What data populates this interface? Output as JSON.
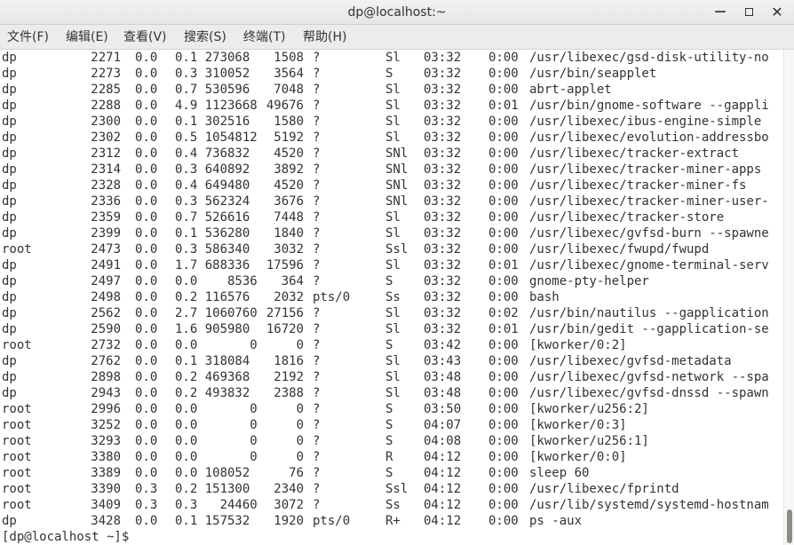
{
  "window": {
    "title": "dp@localhost:~",
    "minimize": "—",
    "close": "✕"
  },
  "menu": [
    "文件(F)",
    "编辑(E)",
    "查看(V)",
    "搜索(S)",
    "终端(T)",
    "帮助(H)"
  ],
  "rows": [
    [
      "dp",
      "2271",
      "0.0",
      "0.1 273068",
      "1508",
      "?",
      "Sl",
      "03:32",
      "0:00",
      "/usr/libexec/gsd-disk-utility-no"
    ],
    [
      "dp",
      "2273",
      "0.0",
      "0.3 310052",
      "3564",
      "?",
      "S",
      "03:32",
      "0:00",
      "/usr/bin/seapplet"
    ],
    [
      "dp",
      "2285",
      "0.0",
      "0.7 530596",
      "7048",
      "?",
      "Sl",
      "03:32",
      "0:00",
      "abrt-applet"
    ],
    [
      "dp",
      "2288",
      "0.0",
      "4.9 1123668",
      "49676",
      "?",
      "Sl",
      "03:32",
      "0:01",
      "/usr/bin/gnome-software --gappli"
    ],
    [
      "dp",
      "2300",
      "0.0",
      "0.1 302516",
      "1580",
      "?",
      "Sl",
      "03:32",
      "0:00",
      "/usr/libexec/ibus-engine-simple"
    ],
    [
      "dp",
      "2302",
      "0.0",
      "0.5 1054812",
      "5192",
      "?",
      "Sl",
      "03:32",
      "0:00",
      "/usr/libexec/evolution-addressbo"
    ],
    [
      "dp",
      "2312",
      "0.0",
      "0.4 736832",
      "4520",
      "?",
      "SNl",
      "03:32",
      "0:00",
      "/usr/libexec/tracker-extract"
    ],
    [
      "dp",
      "2314",
      "0.0",
      "0.3 640892",
      "3892",
      "?",
      "SNl",
      "03:32",
      "0:00",
      "/usr/libexec/tracker-miner-apps"
    ],
    [
      "dp",
      "2328",
      "0.0",
      "0.4 649480",
      "4520",
      "?",
      "SNl",
      "03:32",
      "0:00",
      "/usr/libexec/tracker-miner-fs"
    ],
    [
      "dp",
      "2336",
      "0.0",
      "0.3 562324",
      "3676",
      "?",
      "SNl",
      "03:32",
      "0:00",
      "/usr/libexec/tracker-miner-user-"
    ],
    [
      "dp",
      "2359",
      "0.0",
      "0.7 526616",
      "7448",
      "?",
      "Sl",
      "03:32",
      "0:00",
      "/usr/libexec/tracker-store"
    ],
    [
      "dp",
      "2399",
      "0.0",
      "0.1 536280",
      "1840",
      "?",
      "Sl",
      "03:32",
      "0:00",
      "/usr/libexec/gvfsd-burn --spawne"
    ],
    [
      "root",
      "2473",
      "0.0",
      "0.3 586340",
      "3032",
      "?",
      "Ssl",
      "03:32",
      "0:00",
      "/usr/libexec/fwupd/fwupd"
    ],
    [
      "dp",
      "2491",
      "0.0",
      "1.7 688336",
      "17596",
      "?",
      "Sl",
      "03:32",
      "0:01",
      "/usr/libexec/gnome-terminal-serv"
    ],
    [
      "dp",
      "2497",
      "0.0",
      "0.0    8536",
      "364",
      "?",
      "S",
      "03:32",
      "0:00",
      "gnome-pty-helper"
    ],
    [
      "dp",
      "2498",
      "0.0",
      "0.2 116576",
      "2032",
      "pts/0",
      "Ss",
      "03:32",
      "0:00",
      "bash"
    ],
    [
      "dp",
      "2562",
      "0.0",
      "2.7 1060760",
      "27156",
      "?",
      "Sl",
      "03:32",
      "0:02",
      "/usr/bin/nautilus --gapplication"
    ],
    [
      "dp",
      "2590",
      "0.0",
      "1.6 905980",
      "16720",
      "?",
      "Sl",
      "03:32",
      "0:01",
      "/usr/bin/gedit --gapplication-se"
    ],
    [
      "root",
      "2732",
      "0.0",
      "0.0       0",
      "0",
      "?",
      "S",
      "03:42",
      "0:00",
      "[kworker/0:2]"
    ],
    [
      "dp",
      "2762",
      "0.0",
      "0.1 318084",
      "1816",
      "?",
      "Sl",
      "03:43",
      "0:00",
      "/usr/libexec/gvfsd-metadata"
    ],
    [
      "dp",
      "2898",
      "0.0",
      "0.2 469368",
      "2192",
      "?",
      "Sl",
      "03:48",
      "0:00",
      "/usr/libexec/gvfsd-network --spa"
    ],
    [
      "dp",
      "2943",
      "0.0",
      "0.2 493832",
      "2388",
      "?",
      "Sl",
      "03:48",
      "0:00",
      "/usr/libexec/gvfsd-dnssd --spawn"
    ],
    [
      "root",
      "2996",
      "0.0",
      "0.0       0",
      "0",
      "?",
      "S",
      "03:50",
      "0:00",
      "[kworker/u256:2]"
    ],
    [
      "root",
      "3252",
      "0.0",
      "0.0       0",
      "0",
      "?",
      "S",
      "04:07",
      "0:00",
      "[kworker/0:3]"
    ],
    [
      "root",
      "3293",
      "0.0",
      "0.0       0",
      "0",
      "?",
      "S",
      "04:08",
      "0:00",
      "[kworker/u256:1]"
    ],
    [
      "root",
      "3380",
      "0.0",
      "0.0       0",
      "0",
      "?",
      "R",
      "04:12",
      "0:00",
      "[kworker/0:0]"
    ],
    [
      "root",
      "3389",
      "0.0",
      "0.0 108052",
      "76",
      "?",
      "S",
      "04:12",
      "0:00",
      "sleep 60"
    ],
    [
      "root",
      "3390",
      "0.3",
      "0.2 151300",
      "2340",
      "?",
      "Ssl",
      "04:12",
      "0:00",
      "/usr/libexec/fprintd"
    ],
    [
      "root",
      "3409",
      "0.3",
      "0.3   24460",
      "3072",
      "?",
      "Ss",
      "04:12",
      "0:00",
      "/usr/lib/systemd/systemd-hostnam"
    ],
    [
      "dp",
      "3428",
      "0.0",
      "0.1 157532",
      "1920",
      "pts/0",
      "R+",
      "04:12",
      "0:00",
      "ps -aux"
    ]
  ],
  "prompt": "[dp@localhost ~]$ "
}
